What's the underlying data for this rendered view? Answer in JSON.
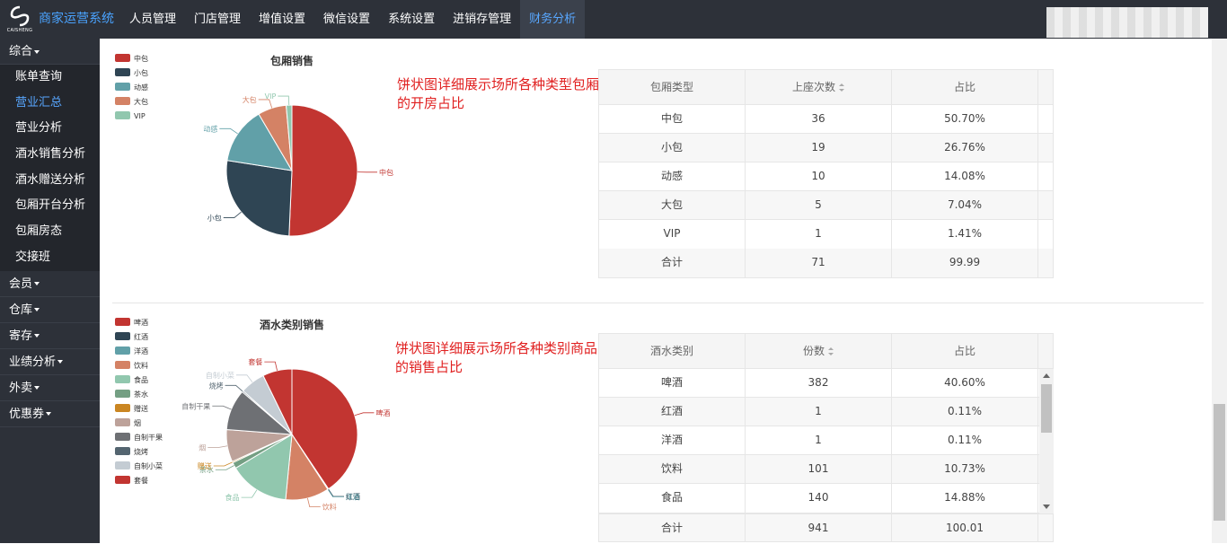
{
  "app": {
    "logo_text": "CAISHENG",
    "brand": "商家运营系统"
  },
  "nav": [
    {
      "label": "人员管理"
    },
    {
      "label": "门店管理"
    },
    {
      "label": "增值设置"
    },
    {
      "label": "微信设置"
    },
    {
      "label": "系统设置"
    },
    {
      "label": "进销存管理"
    },
    {
      "label": "财务分析",
      "active": true
    }
  ],
  "sidebar": {
    "groups": [
      {
        "label": "综合",
        "items": [
          {
            "label": "账单查询"
          },
          {
            "label": "营业汇总",
            "active": true
          },
          {
            "label": "营业分析"
          },
          {
            "label": "酒水销售分析"
          },
          {
            "label": "酒水赠送分析"
          },
          {
            "label": "包厢开台分析"
          },
          {
            "label": "包厢房态"
          },
          {
            "label": "交接班"
          }
        ]
      },
      {
        "label": "会员"
      },
      {
        "label": "仓库"
      },
      {
        "label": "寄存"
      },
      {
        "label": "业绩分析"
      },
      {
        "label": "外卖"
      },
      {
        "label": "优惠券"
      }
    ]
  },
  "section1": {
    "note": "饼状图详细展示场所各种类型包厢的开房占比",
    "columns": [
      "包厢类型",
      "上座次数",
      "占比"
    ],
    "rows": [
      [
        "中包",
        "36",
        "50.70%"
      ],
      [
        "小包",
        "19",
        "26.76%"
      ],
      [
        "动感",
        "10",
        "14.08%"
      ],
      [
        "大包",
        "5",
        "7.04%"
      ],
      [
        "VIP",
        "1",
        "1.41%"
      ]
    ],
    "total": [
      "合计",
      "71",
      "99.99"
    ]
  },
  "section2": {
    "note": "饼状图详细展示场所各种类别商品的销售占比",
    "columns": [
      "酒水类别",
      "份数",
      "占比"
    ],
    "rows": [
      [
        "啤酒",
        "382",
        "40.60%"
      ],
      [
        "红酒",
        "1",
        "0.11%"
      ],
      [
        "洋酒",
        "1",
        "0.11%"
      ],
      [
        "饮料",
        "101",
        "10.73%"
      ],
      [
        "食品",
        "140",
        "14.88%"
      ]
    ],
    "total": [
      "合计",
      "941",
      "100.01"
    ]
  },
  "chart_data": [
    {
      "type": "pie",
      "title": "包厢销售",
      "legend_position": "top-left",
      "categories": [
        "中包",
        "小包",
        "动感",
        "大包",
        "VIP"
      ],
      "values": [
        36,
        19,
        10,
        5,
        1
      ],
      "colors": [
        "#c23531",
        "#2f4554",
        "#61a0a8",
        "#d48265",
        "#91c7ae"
      ]
    },
    {
      "type": "pie",
      "title": "酒水类别销售",
      "legend_position": "top-left",
      "categories": [
        "啤酒",
        "红酒",
        "洋酒",
        "饮料",
        "食品",
        "茶水",
        "赠送",
        "烟",
        "自制干果",
        "烧烤",
        "自制小菜",
        "套餐"
      ],
      "values": [
        382,
        1,
        1,
        101,
        140,
        14,
        3,
        75,
        95,
        3,
        58,
        68
      ],
      "colors": [
        "#c23531",
        "#2f4554",
        "#61a0a8",
        "#d48265",
        "#91c7ae",
        "#749f83",
        "#ca8622",
        "#bda29a",
        "#6e7074",
        "#546570",
        "#c4ccd3",
        "#c23531"
      ]
    }
  ]
}
